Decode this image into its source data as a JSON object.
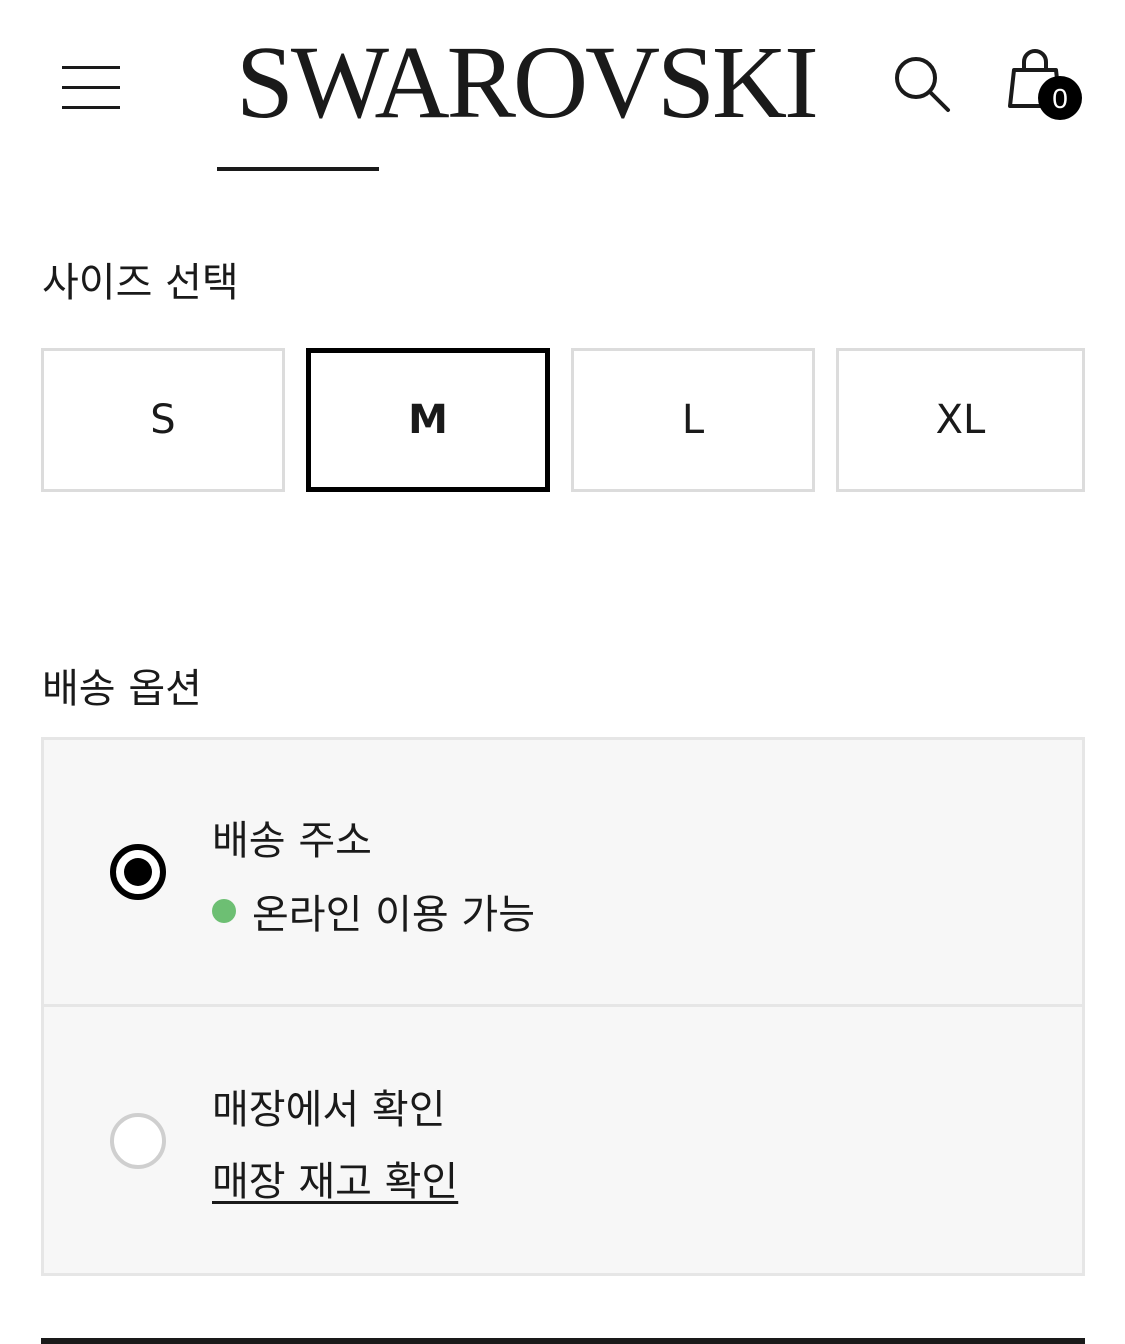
{
  "header": {
    "brand": "SWAROVSKI",
    "menu_icon": "hamburger-menu-icon",
    "search_icon": "search-icon",
    "cart_icon": "shopping-bag-icon",
    "cart_count": "0"
  },
  "size": {
    "title": "사이즈 선택",
    "options": [
      {
        "label": "S",
        "selected": false
      },
      {
        "label": "M",
        "selected": true
      },
      {
        "label": "L",
        "selected": false
      },
      {
        "label": "XL",
        "selected": false
      }
    ]
  },
  "delivery": {
    "title": "배송 옵션",
    "ship": {
      "label": "배송 주소",
      "availability": "온라인 이용 가능",
      "selected": true,
      "status_color": "#6dbf73"
    },
    "store": {
      "label": "매장에서 확인",
      "link": "매장 재고 확인",
      "selected": false
    }
  },
  "colors": {
    "text": "#1a1a1a",
    "selected_border": "#000000",
    "option_border": "#dcdcdc",
    "panel_background": "#f7f7f7",
    "available_dot": "#6dbf73"
  }
}
